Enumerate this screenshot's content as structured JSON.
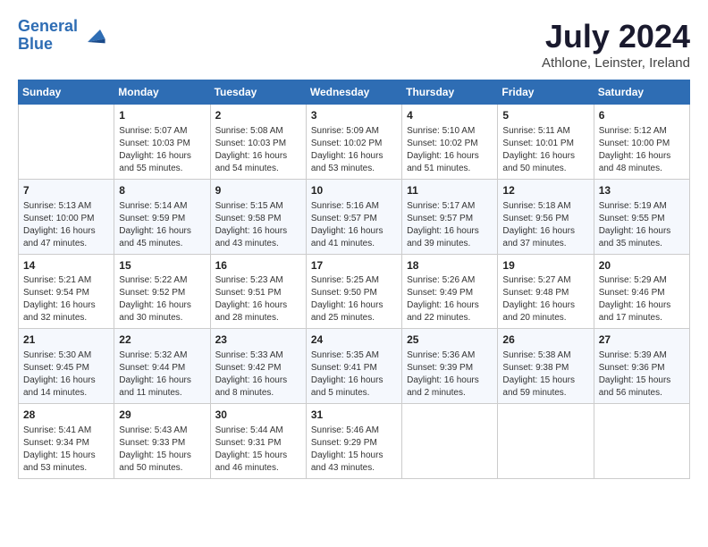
{
  "logo": {
    "line1": "General",
    "line2": "Blue"
  },
  "title": "July 2024",
  "subtitle": "Athlone, Leinster, Ireland",
  "headers": [
    "Sunday",
    "Monday",
    "Tuesday",
    "Wednesday",
    "Thursday",
    "Friday",
    "Saturday"
  ],
  "weeks": [
    [
      {
        "day": "",
        "info": ""
      },
      {
        "day": "1",
        "info": "Sunrise: 5:07 AM\nSunset: 10:03 PM\nDaylight: 16 hours\nand 55 minutes."
      },
      {
        "day": "2",
        "info": "Sunrise: 5:08 AM\nSunset: 10:03 PM\nDaylight: 16 hours\nand 54 minutes."
      },
      {
        "day": "3",
        "info": "Sunrise: 5:09 AM\nSunset: 10:02 PM\nDaylight: 16 hours\nand 53 minutes."
      },
      {
        "day": "4",
        "info": "Sunrise: 5:10 AM\nSunset: 10:02 PM\nDaylight: 16 hours\nand 51 minutes."
      },
      {
        "day": "5",
        "info": "Sunrise: 5:11 AM\nSunset: 10:01 PM\nDaylight: 16 hours\nand 50 minutes."
      },
      {
        "day": "6",
        "info": "Sunrise: 5:12 AM\nSunset: 10:00 PM\nDaylight: 16 hours\nand 48 minutes."
      }
    ],
    [
      {
        "day": "7",
        "info": "Sunrise: 5:13 AM\nSunset: 10:00 PM\nDaylight: 16 hours\nand 47 minutes."
      },
      {
        "day": "8",
        "info": "Sunrise: 5:14 AM\nSunset: 9:59 PM\nDaylight: 16 hours\nand 45 minutes."
      },
      {
        "day": "9",
        "info": "Sunrise: 5:15 AM\nSunset: 9:58 PM\nDaylight: 16 hours\nand 43 minutes."
      },
      {
        "day": "10",
        "info": "Sunrise: 5:16 AM\nSunset: 9:57 PM\nDaylight: 16 hours\nand 41 minutes."
      },
      {
        "day": "11",
        "info": "Sunrise: 5:17 AM\nSunset: 9:57 PM\nDaylight: 16 hours\nand 39 minutes."
      },
      {
        "day": "12",
        "info": "Sunrise: 5:18 AM\nSunset: 9:56 PM\nDaylight: 16 hours\nand 37 minutes."
      },
      {
        "day": "13",
        "info": "Sunrise: 5:19 AM\nSunset: 9:55 PM\nDaylight: 16 hours\nand 35 minutes."
      }
    ],
    [
      {
        "day": "14",
        "info": "Sunrise: 5:21 AM\nSunset: 9:54 PM\nDaylight: 16 hours\nand 32 minutes."
      },
      {
        "day": "15",
        "info": "Sunrise: 5:22 AM\nSunset: 9:52 PM\nDaylight: 16 hours\nand 30 minutes."
      },
      {
        "day": "16",
        "info": "Sunrise: 5:23 AM\nSunset: 9:51 PM\nDaylight: 16 hours\nand 28 minutes."
      },
      {
        "day": "17",
        "info": "Sunrise: 5:25 AM\nSunset: 9:50 PM\nDaylight: 16 hours\nand 25 minutes."
      },
      {
        "day": "18",
        "info": "Sunrise: 5:26 AM\nSunset: 9:49 PM\nDaylight: 16 hours\nand 22 minutes."
      },
      {
        "day": "19",
        "info": "Sunrise: 5:27 AM\nSunset: 9:48 PM\nDaylight: 16 hours\nand 20 minutes."
      },
      {
        "day": "20",
        "info": "Sunrise: 5:29 AM\nSunset: 9:46 PM\nDaylight: 16 hours\nand 17 minutes."
      }
    ],
    [
      {
        "day": "21",
        "info": "Sunrise: 5:30 AM\nSunset: 9:45 PM\nDaylight: 16 hours\nand 14 minutes."
      },
      {
        "day": "22",
        "info": "Sunrise: 5:32 AM\nSunset: 9:44 PM\nDaylight: 16 hours\nand 11 minutes."
      },
      {
        "day": "23",
        "info": "Sunrise: 5:33 AM\nSunset: 9:42 PM\nDaylight: 16 hours\nand 8 minutes."
      },
      {
        "day": "24",
        "info": "Sunrise: 5:35 AM\nSunset: 9:41 PM\nDaylight: 16 hours\nand 5 minutes."
      },
      {
        "day": "25",
        "info": "Sunrise: 5:36 AM\nSunset: 9:39 PM\nDaylight: 16 hours\nand 2 minutes."
      },
      {
        "day": "26",
        "info": "Sunrise: 5:38 AM\nSunset: 9:38 PM\nDaylight: 15 hours\nand 59 minutes."
      },
      {
        "day": "27",
        "info": "Sunrise: 5:39 AM\nSunset: 9:36 PM\nDaylight: 15 hours\nand 56 minutes."
      }
    ],
    [
      {
        "day": "28",
        "info": "Sunrise: 5:41 AM\nSunset: 9:34 PM\nDaylight: 15 hours\nand 53 minutes."
      },
      {
        "day": "29",
        "info": "Sunrise: 5:43 AM\nSunset: 9:33 PM\nDaylight: 15 hours\nand 50 minutes."
      },
      {
        "day": "30",
        "info": "Sunrise: 5:44 AM\nSunset: 9:31 PM\nDaylight: 15 hours\nand 46 minutes."
      },
      {
        "day": "31",
        "info": "Sunrise: 5:46 AM\nSunset: 9:29 PM\nDaylight: 15 hours\nand 43 minutes."
      },
      {
        "day": "",
        "info": ""
      },
      {
        "day": "",
        "info": ""
      },
      {
        "day": "",
        "info": ""
      }
    ]
  ]
}
